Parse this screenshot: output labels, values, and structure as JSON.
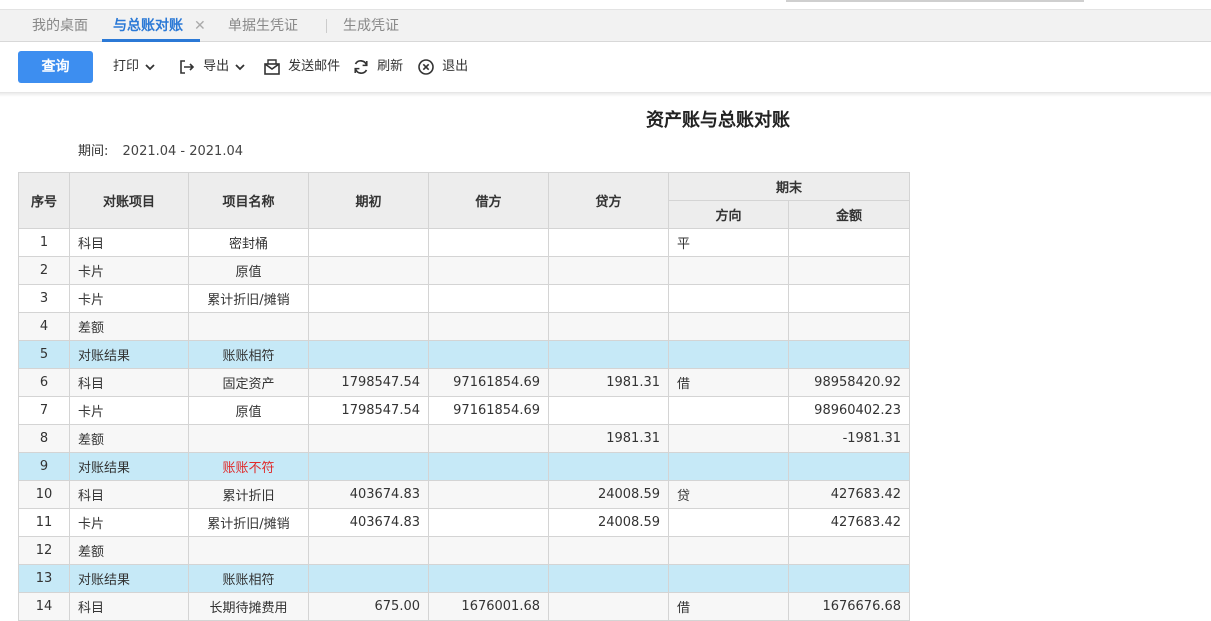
{
  "tabs": [
    {
      "label": "我的桌面",
      "active": false
    },
    {
      "label": "与总账对账",
      "active": true,
      "closable": true
    },
    {
      "label": "单据生凭证",
      "active": false
    },
    {
      "label": "生成凭证",
      "active": false
    }
  ],
  "toolbar": {
    "query": "查询",
    "print": "打印",
    "export": "导出",
    "email": "发送邮件",
    "refresh": "刷新",
    "exit": "退出"
  },
  "report": {
    "title": "资产账与总账对账",
    "period_label": "期间:",
    "period_value": "2021.04 - 2021.04"
  },
  "table": {
    "headers": {
      "no": "序号",
      "item": "对账项目",
      "name": "项目名称",
      "opening": "期初",
      "debit": "借方",
      "credit": "贷方",
      "ending": "期末",
      "direction": "方向",
      "amount": "金额"
    },
    "rows": [
      {
        "no": "1",
        "item": "科目",
        "name": "密封桶",
        "opening": "",
        "debit": "",
        "credit": "",
        "direction": "平",
        "amount": "",
        "type": "normal"
      },
      {
        "no": "2",
        "item": "卡片",
        "name": "原值",
        "opening": "",
        "debit": "",
        "credit": "",
        "direction": "",
        "amount": "",
        "type": "alt"
      },
      {
        "no": "3",
        "item": "卡片",
        "name": "累计折旧/摊销",
        "opening": "",
        "debit": "",
        "credit": "",
        "direction": "",
        "amount": "",
        "type": "normal"
      },
      {
        "no": "4",
        "item": "差额",
        "name": "",
        "opening": "",
        "debit": "",
        "credit": "",
        "direction": "",
        "amount": "",
        "type": "alt"
      },
      {
        "no": "5",
        "item": "对账结果",
        "name": "账账相符",
        "opening": "",
        "debit": "",
        "credit": "",
        "direction": "",
        "amount": "",
        "type": "result"
      },
      {
        "no": "6",
        "item": "科目",
        "name": "固定资产",
        "opening": "1798547.54",
        "debit": "97161854.69",
        "credit": "1981.31",
        "direction": "借",
        "amount": "98958420.92",
        "type": "alt"
      },
      {
        "no": "7",
        "item": "卡片",
        "name": "原值",
        "opening": "1798547.54",
        "debit": "97161854.69",
        "credit": "",
        "direction": "",
        "amount": "98960402.23",
        "type": "normal"
      },
      {
        "no": "8",
        "item": "差额",
        "name": "",
        "opening": "",
        "debit": "",
        "credit": "1981.31",
        "direction": "",
        "amount": "-1981.31",
        "type": "alt"
      },
      {
        "no": "9",
        "item": "对账结果",
        "name": "账账不符",
        "opening": "",
        "debit": "",
        "credit": "",
        "direction": "",
        "amount": "",
        "type": "result"
      },
      {
        "no": "10",
        "item": "科目",
        "name": "累计折旧",
        "opening": "403674.83",
        "debit": "",
        "credit": "24008.59",
        "direction": "贷",
        "amount": "427683.42",
        "type": "alt"
      },
      {
        "no": "11",
        "item": "卡片",
        "name": "累计折旧/摊销",
        "opening": "403674.83",
        "debit": "",
        "credit": "24008.59",
        "direction": "",
        "amount": "427683.42",
        "type": "normal"
      },
      {
        "no": "12",
        "item": "差额",
        "name": "",
        "opening": "",
        "debit": "",
        "credit": "",
        "direction": "",
        "amount": "",
        "type": "alt"
      },
      {
        "no": "13",
        "item": "对账结果",
        "name": "账账相符",
        "opening": "",
        "debit": "",
        "credit": "",
        "direction": "",
        "amount": "",
        "type": "result"
      },
      {
        "no": "14",
        "item": "科目",
        "name": "长期待摊费用",
        "opening": "675.00",
        "debit": "1676001.68",
        "credit": "",
        "direction": "借",
        "amount": "1676676.68",
        "type": "alt"
      }
    ]
  },
  "colors": {
    "accent": "#2b79d6",
    "query_button": "#3d8ef0",
    "result_row": "#c6e9f7",
    "mismatch": "#e02b2b",
    "link_text": "#2a3aa8"
  }
}
